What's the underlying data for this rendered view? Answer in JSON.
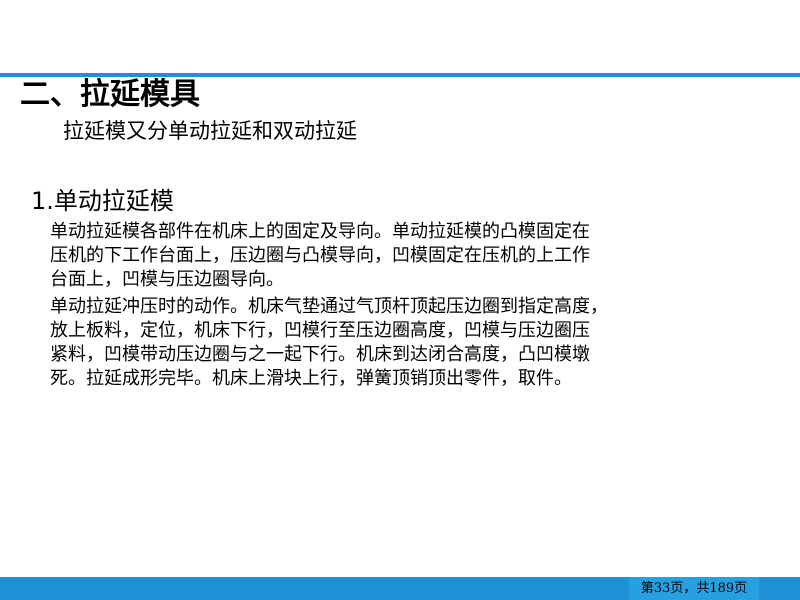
{
  "slide": {
    "heading": "二、拉延模具",
    "subheading": "拉延模又分单动拉延和双动拉延",
    "section_title": "1.单动拉延模",
    "paragraph_1": [
      "单动拉延模各部件在机床上的固定及导向。单动拉延模的凸模固定在",
      "压机的下工作台面上，压边圈与凸模导向，凹模固定在压机的上工作",
      "台面上，凹模与压边圈导向。"
    ],
    "paragraph_2": [
      "单动拉延冲压时的动作。机床气垫通过气顶杆顶起压边圈到指定高度，",
      "放上板料，定位，机床下行，凹模行至压边圈高度，凹模与压边圈压",
      "紧料，凹模带动压边圈与之一起下行。机床到达闭合高度，凸凹模墩",
      "死。拉延成形完毕。机床上滑块上行，弹簧顶销顶出零件，取件。"
    ]
  },
  "footer": {
    "page_indicator": "第33页，共189页"
  },
  "colors": {
    "accent": "#1f8fd6",
    "page_box": "#26a0e0"
  }
}
